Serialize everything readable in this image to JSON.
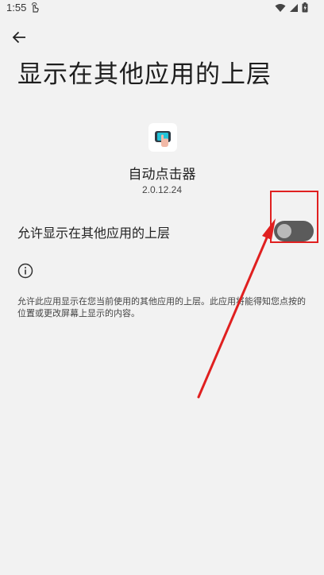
{
  "status_bar": {
    "time": "1:55",
    "icons": [
      "touch-icon",
      "wifi-icon",
      "signal-icon",
      "battery-icon"
    ]
  },
  "header": {
    "back_icon": "arrow-left-icon",
    "title": "显示在其他应用的上层"
  },
  "app": {
    "name": "自动点击器",
    "version": "2.0.12.24"
  },
  "setting": {
    "label": "允许显示在其他应用的上层",
    "toggle_on": false
  },
  "info": {
    "icon": "info-icon",
    "text": "允许此应用显示在您当前使用的其他应用的上层。此应用将能得知您点按的位置或更改屏幕上显示的内容。"
  },
  "colors": {
    "background": "#f2f2f2",
    "toggle_track": "#5b5b5b",
    "toggle_thumb": "#b9b9b9",
    "annotation": "#e02020"
  }
}
